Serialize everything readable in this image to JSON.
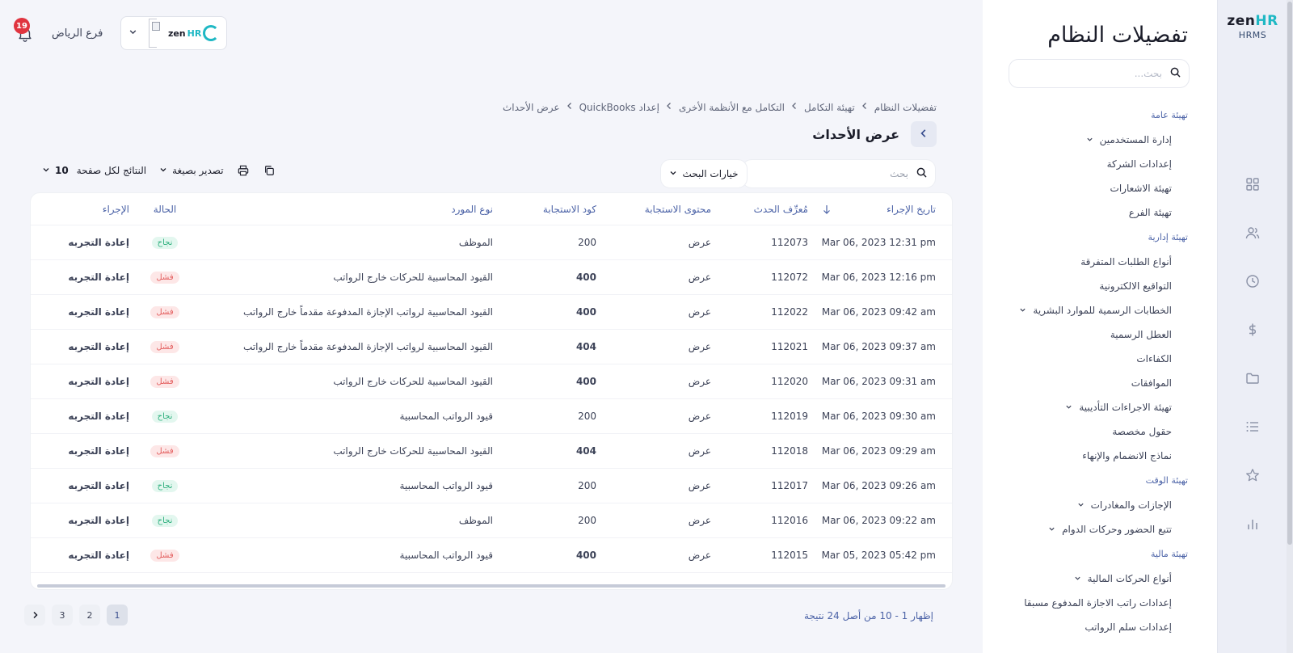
{
  "rail": {
    "brand_prefix": "zen",
    "brand_suffix": "HR",
    "product": "HRMS",
    "icons": [
      "grid-icon",
      "users-icon",
      "clock-icon",
      "dollar-icon",
      "folder-icon",
      "list-icon",
      "star-icon",
      "bar-chart-icon"
    ]
  },
  "settings": {
    "title": "تفضيلات النظام",
    "search_placeholder": "بحث...",
    "groups": [
      {
        "heading": "تهيئة عامة",
        "items": [
          {
            "label": "إدارة المستخدمين",
            "expandable": true
          },
          {
            "label": "إعدادات الشركة",
            "expandable": false
          },
          {
            "label": "تهيئة الاشعارات",
            "expandable": false
          },
          {
            "label": "تهيئة الفرع",
            "expandable": false
          }
        ]
      },
      {
        "heading": "تهيئة إدارية",
        "items": [
          {
            "label": "أنواع الطلبات المتفرقة",
            "expandable": false
          },
          {
            "label": "التواقيع الالكترونية",
            "expandable": false
          },
          {
            "label": "الخطابات الرسمية للموارد البشرية",
            "expandable": true
          },
          {
            "label": "العطل الرسمية",
            "expandable": false
          },
          {
            "label": "الكفاءات",
            "expandable": false
          },
          {
            "label": "الموافقات",
            "expandable": false
          },
          {
            "label": "تهيئة الاجراءات التأديبية",
            "expandable": true
          },
          {
            "label": "حقول مخصصة",
            "expandable": false
          },
          {
            "label": "نماذج الانضمام والإنهاء",
            "expandable": false
          }
        ]
      },
      {
        "heading": "تهيئة الوقت",
        "items": [
          {
            "label": "الإجازات والمغادرات",
            "expandable": true
          },
          {
            "label": "تتبع الحضور وحركات الدوام",
            "expandable": true
          }
        ]
      },
      {
        "heading": "تهيئة مالية",
        "items": [
          {
            "label": "أنواع الحركات المالية",
            "expandable": true
          },
          {
            "label": "إعدادات راتب الاجازة المدفوع مسبقا",
            "expandable": false
          },
          {
            "label": "إعدادات سلم الرواتب",
            "expandable": false
          }
        ]
      }
    ]
  },
  "topbar": {
    "branch": "فرع الرياض",
    "notifications": "19",
    "mini_logo_prefix": "zen",
    "mini_logo_suffix": "HR"
  },
  "breadcrumb": [
    "تفضيلات النظام",
    "تهيئة التكامل",
    "التكامل مع الأنظمة الأخرى",
    "إعداد QuickBooks",
    "عرض الأحداث"
  ],
  "page_title": "عرض الأحداث",
  "toolbar": {
    "search_placeholder": "بحث",
    "search_options": "خيارات البحث",
    "export": "تصدير بصيغة",
    "per_page_label": "النتائج لكل صفحة",
    "per_page_value": "10"
  },
  "table": {
    "columns": {
      "date": "تاريخ الإجراء",
      "event_id": "مُعرِّف الحدث",
      "content": "محتوى الاستجابة",
      "code": "كود الاستجابة",
      "vendor": "نوع المورد",
      "status": "الحالة",
      "action": "الإجراء"
    },
    "view_label": "عرض",
    "retry_label": "إعادة التجربه",
    "status_success": "نجاح",
    "status_fail": "فشل",
    "rows": [
      {
        "date": "Mar 06, 2023 12:31 pm",
        "id": "112073",
        "code": "200",
        "vendor": "الموظف",
        "ok": true
      },
      {
        "date": "Mar 06, 2023 12:16 pm",
        "id": "112072",
        "code": "400",
        "vendor": "القيود المحاسبية للحركات خارج الرواتب",
        "ok": false
      },
      {
        "date": "Mar 06, 2023 09:42 am",
        "id": "112022",
        "code": "400",
        "vendor": "القيود المحاسبية لرواتب الإجازة المدفوعة مقدماً خارج الرواتب",
        "ok": false
      },
      {
        "date": "Mar 06, 2023 09:37 am",
        "id": "112021",
        "code": "404",
        "vendor": "القيود المحاسبية لرواتب الإجازة المدفوعة مقدماً خارج الرواتب",
        "ok": false
      },
      {
        "date": "Mar 06, 2023 09:31 am",
        "id": "112020",
        "code": "400",
        "vendor": "القيود المحاسبية للحركات خارج الرواتب",
        "ok": false
      },
      {
        "date": "Mar 06, 2023 09:30 am",
        "id": "112019",
        "code": "200",
        "vendor": "قيود الرواتب المحاسبية",
        "ok": true
      },
      {
        "date": "Mar 06, 2023 09:29 am",
        "id": "112018",
        "code": "404",
        "vendor": "القيود المحاسبية للحركات خارج الرواتب",
        "ok": false
      },
      {
        "date": "Mar 06, 2023 09:26 am",
        "id": "112017",
        "code": "200",
        "vendor": "قيود الرواتب المحاسبية",
        "ok": true
      },
      {
        "date": "Mar 06, 2023 09:22 am",
        "id": "112016",
        "code": "200",
        "vendor": "الموظف",
        "ok": true
      },
      {
        "date": "Mar 05, 2023 05:42 pm",
        "id": "112015",
        "code": "400",
        "vendor": "قيود الرواتب المحاسبية",
        "ok": false
      }
    ]
  },
  "footer": {
    "result_info": "إظهار 1 - 10 من أصل 24 نتيجة",
    "pages": [
      "1",
      "2",
      "3"
    ],
    "current_page": "1"
  },
  "colors": {
    "accent": "#1fb8c4",
    "link": "#1fa3a8",
    "heading": "#4c63a7",
    "badge": "#e0343f",
    "success": "#2fb07e",
    "fail": "#e35d5d"
  }
}
